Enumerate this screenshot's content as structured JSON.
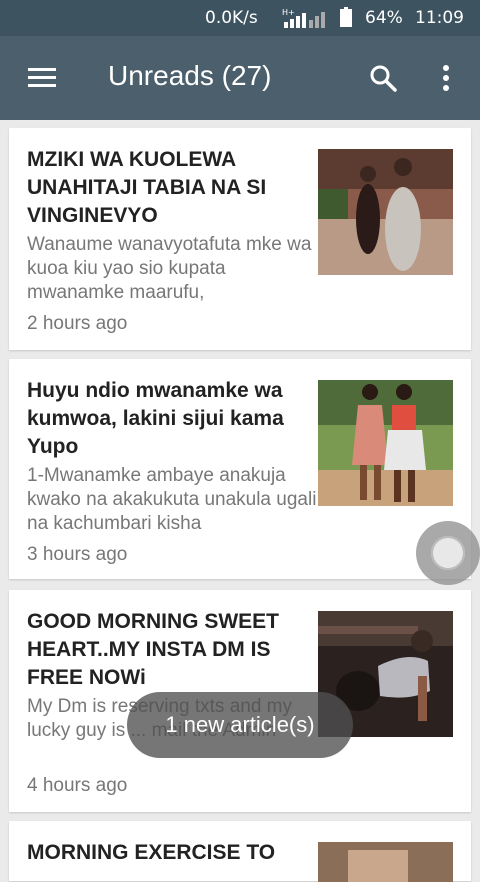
{
  "status_bar": {
    "network_speed": "0.0K/s",
    "battery_percent": "64%",
    "time": "11:09"
  },
  "app_bar": {
    "title": "Unreads (27)"
  },
  "articles": [
    {
      "headline": "MZIKI WA KUOLEWA UNAHITAJI TABIA NA SI VINGINEVYO",
      "snippet": "Wanaume wanavyotafuta mke wa kuoa kiu yao sio kupata mwanamke maarufu,",
      "time": "2 hours ago"
    },
    {
      "headline": "Huyu ndio mwanamke wa kumwoa, lakini sijui kama Yupo",
      "snippet": "1-Mwanamke ambaye anakuja kwako na akakukuta unakula ugali na kachumbari kisha",
      "time": "3 hours ago"
    },
    {
      "headline": "GOOD MORNING SWEET HEART..MY INSTA DM IS FREE NOWi",
      "snippet": "My Dm is reserving txts and my lucky guy is ... mail the Admin",
      "time": "4 hours ago"
    },
    {
      "headline": "MORNING EXERCISE TO",
      "snippet": "",
      "time": ""
    }
  ],
  "toast": {
    "message": "1 new article(s)"
  }
}
